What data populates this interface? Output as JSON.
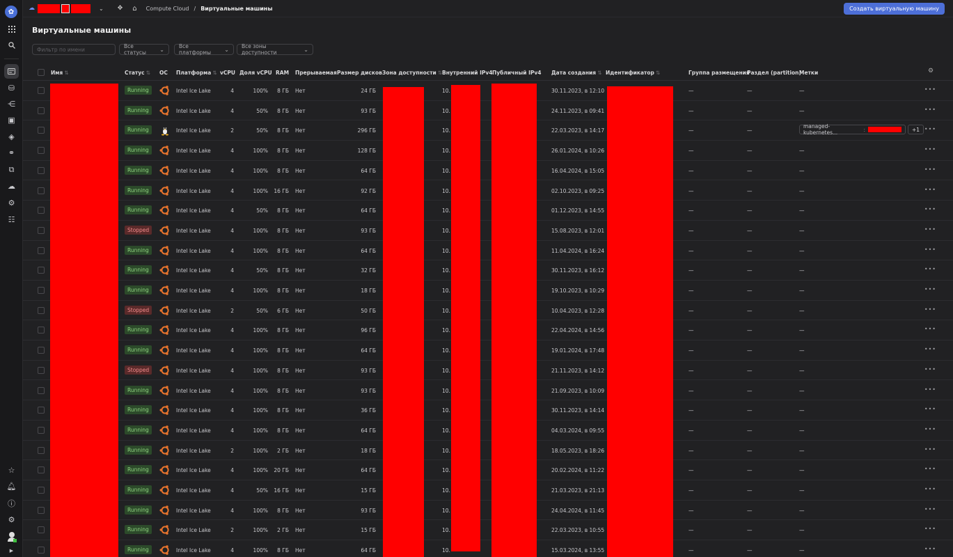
{
  "topbar": {
    "breadcrumb_service": "Compute Cloud",
    "breadcrumb_separator": "/",
    "breadcrumb_current": "Виртуальные машины",
    "create_button": "Создать виртуальную машину"
  },
  "page": {
    "title": "Виртуальные машины"
  },
  "filters": {
    "name_placeholder": "Фильтр по имени",
    "status": "Все статусы",
    "platform": "Все платформы",
    "zone": "Все зоны доступности"
  },
  "columns": {
    "name": "Имя",
    "status": "Статус",
    "os": "ОС",
    "platform": "Платформа",
    "vcpu": "vCPU",
    "vcpu_share": "Доля vCPU",
    "ram": "RAM",
    "preemptible": "Прерываемая",
    "disk": "Размер дисков",
    "zone": "Зона доступности",
    "ipv4_internal": "Внутренний IPv4",
    "ipv4_public": "Публичный IPv4",
    "created": "Дата создания",
    "id": "Идентификатор",
    "placement_group": "Группа размещения",
    "partition": "Раздел (partition)",
    "labels": "Метки"
  },
  "icons": {
    "logo": "settings-gear-logo",
    "apps": "grid-icon",
    "search": "search-icon",
    "os_ubuntu": "ubuntu-icon",
    "os_linux": "tux-icon",
    "more": "ellipsis-icon"
  },
  "colors": {
    "accent": "#4d6fd8",
    "running": "#8fd27f",
    "stopped": "#f08a8a",
    "redaction": "#ff0000"
  },
  "rows": [
    {
      "status": "Running",
      "os": "ubuntu",
      "platform": "Intel Ice Lake",
      "vcpu": "4",
      "share": "100%",
      "ram": "8 ГБ",
      "pre": "Нет",
      "disk": "24 ГБ",
      "ip": "10.",
      "created": "30.11.2023, в 12:10",
      "pg": "—",
      "part": "—",
      "labels": "—"
    },
    {
      "status": "Running",
      "os": "ubuntu",
      "platform": "Intel Ice Lake",
      "vcpu": "4",
      "share": "50%",
      "ram": "8 ГБ",
      "pre": "Нет",
      "disk": "93 ГБ",
      "ip": "10.",
      "created": "24.11.2023, в 09:41",
      "pg": "—",
      "part": "—",
      "labels": "—"
    },
    {
      "status": "Running",
      "os": "linux",
      "platform": "Intel Ice Lake",
      "vcpu": "2",
      "share": "50%",
      "ram": "8 ГБ",
      "pre": "Нет",
      "disk": "296 ГБ",
      "ip": "10.",
      "created": "22.03.2023, в 14:17",
      "pg": "—",
      "part": "—",
      "labels": "managed-kubernetes...",
      "labels_more": "+1"
    },
    {
      "status": "Running",
      "os": "ubuntu",
      "platform": "Intel Ice Lake",
      "vcpu": "4",
      "share": "100%",
      "ram": "8 ГБ",
      "pre": "Нет",
      "disk": "128 ГБ",
      "ip": "10.",
      "created": "26.01.2024, в 10:26",
      "pg": "—",
      "part": "—",
      "labels": "—"
    },
    {
      "status": "Running",
      "os": "ubuntu",
      "platform": "Intel Ice Lake",
      "vcpu": "4",
      "share": "100%",
      "ram": "8 ГБ",
      "pre": "Нет",
      "disk": "64 ГБ",
      "ip": "10.",
      "created": "16.04.2024, в 15:05",
      "pg": "—",
      "part": "—",
      "labels": "—"
    },
    {
      "status": "Running",
      "os": "ubuntu",
      "platform": "Intel Ice Lake",
      "vcpu": "4",
      "share": "100%",
      "ram": "16 ГБ",
      "pre": "Нет",
      "disk": "92 ГБ",
      "ip": "10.",
      "created": "02.10.2023, в 09:25",
      "pg": "—",
      "part": "—",
      "labels": "—"
    },
    {
      "status": "Running",
      "os": "ubuntu",
      "platform": "Intel Ice Lake",
      "vcpu": "4",
      "share": "50%",
      "ram": "8 ГБ",
      "pre": "Нет",
      "disk": "64 ГБ",
      "ip": "10.",
      "created": "01.12.2023, в 14:55",
      "pg": "—",
      "part": "—",
      "labels": "—"
    },
    {
      "status": "Stopped",
      "os": "ubuntu",
      "platform": "Intel Ice Lake",
      "vcpu": "4",
      "share": "100%",
      "ram": "8 ГБ",
      "pre": "Нет",
      "disk": "93 ГБ",
      "ip": "10.",
      "created": "15.08.2023, в 12:01",
      "pg": "—",
      "part": "—",
      "labels": "—"
    },
    {
      "status": "Running",
      "os": "ubuntu",
      "platform": "Intel Ice Lake",
      "vcpu": "4",
      "share": "100%",
      "ram": "8 ГБ",
      "pre": "Нет",
      "disk": "64 ГБ",
      "ip": "10.",
      "created": "11.04.2024, в 16:24",
      "pg": "—",
      "part": "—",
      "labels": "—"
    },
    {
      "status": "Running",
      "os": "ubuntu",
      "platform": "Intel Ice Lake",
      "vcpu": "4",
      "share": "50%",
      "ram": "8 ГБ",
      "pre": "Нет",
      "disk": "32 ГБ",
      "ip": "10.",
      "created": "30.11.2023, в 16:12",
      "pg": "—",
      "part": "—",
      "labels": "—"
    },
    {
      "status": "Running",
      "os": "ubuntu",
      "platform": "Intel Ice Lake",
      "vcpu": "4",
      "share": "100%",
      "ram": "8 ГБ",
      "pre": "Нет",
      "disk": "18 ГБ",
      "ip": "10.",
      "created": "19.10.2023, в 10:29",
      "pg": "—",
      "part": "—",
      "labels": "—"
    },
    {
      "status": "Stopped",
      "os": "ubuntu",
      "platform": "Intel Ice Lake",
      "vcpu": "2",
      "share": "50%",
      "ram": "6 ГБ",
      "pre": "Нет",
      "disk": "50 ГБ",
      "ip": "10.",
      "created": "10.04.2023, в 12:28",
      "pg": "—",
      "part": "—",
      "labels": "—"
    },
    {
      "status": "Running",
      "os": "ubuntu",
      "platform": "Intel Ice Lake",
      "vcpu": "4",
      "share": "100%",
      "ram": "8 ГБ",
      "pre": "Нет",
      "disk": "96 ГБ",
      "ip": "10.",
      "created": "22.04.2024, в 14:56",
      "pg": "—",
      "part": "—",
      "labels": "—"
    },
    {
      "status": "Running",
      "os": "ubuntu",
      "platform": "Intel Ice Lake",
      "vcpu": "4",
      "share": "100%",
      "ram": "8 ГБ",
      "pre": "Нет",
      "disk": "64 ГБ",
      "ip": "10.",
      "created": "19.01.2024, в 17:48",
      "pg": "—",
      "part": "—",
      "labels": "—"
    },
    {
      "status": "Stopped",
      "os": "ubuntu",
      "platform": "Intel Ice Lake",
      "vcpu": "4",
      "share": "100%",
      "ram": "8 ГБ",
      "pre": "Нет",
      "disk": "93 ГБ",
      "ip": "10.",
      "created": "21.11.2023, в 14:12",
      "pg": "—",
      "part": "—",
      "labels": "—"
    },
    {
      "status": "Running",
      "os": "ubuntu",
      "platform": "Intel Ice Lake",
      "vcpu": "4",
      "share": "100%",
      "ram": "8 ГБ",
      "pre": "Нет",
      "disk": "93 ГБ",
      "ip": "10.",
      "created": "21.09.2023, в 10:09",
      "pg": "—",
      "part": "—",
      "labels": "—"
    },
    {
      "status": "Running",
      "os": "ubuntu",
      "platform": "Intel Ice Lake",
      "vcpu": "4",
      "share": "100%",
      "ram": "8 ГБ",
      "pre": "Нет",
      "disk": "36 ГБ",
      "ip": "10.",
      "created": "30.11.2023, в 14:14",
      "pg": "—",
      "part": "—",
      "labels": "—"
    },
    {
      "status": "Running",
      "os": "ubuntu",
      "platform": "Intel Ice Lake",
      "vcpu": "4",
      "share": "100%",
      "ram": "8 ГБ",
      "pre": "Нет",
      "disk": "64 ГБ",
      "ip": "10.",
      "created": "04.03.2024, в 09:55",
      "pg": "—",
      "part": "—",
      "labels": "—"
    },
    {
      "status": "Running",
      "os": "ubuntu",
      "platform": "Intel Ice Lake",
      "vcpu": "2",
      "share": "100%",
      "ram": "2 ГБ",
      "pre": "Нет",
      "disk": "18 ГБ",
      "ip": "10.",
      "created": "18.05.2023, в 18:26",
      "pg": "—",
      "part": "—",
      "labels": "—"
    },
    {
      "status": "Running",
      "os": "ubuntu",
      "platform": "Intel Ice Lake",
      "vcpu": "4",
      "share": "100%",
      "ram": "20 ГБ",
      "pre": "Нет",
      "disk": "64 ГБ",
      "ip": "10.",
      "created": "20.02.2024, в 11:22",
      "pg": "—",
      "part": "—",
      "labels": "—"
    },
    {
      "status": "Running",
      "os": "ubuntu",
      "platform": "Intel Ice Lake",
      "vcpu": "4",
      "share": "50%",
      "ram": "16 ГБ",
      "pre": "Нет",
      "disk": "15 ГБ",
      "ip": "10.",
      "created": "21.03.2023, в 21:13",
      "pg": "—",
      "part": "—",
      "labels": "—"
    },
    {
      "status": "Running",
      "os": "ubuntu",
      "platform": "Intel Ice Lake",
      "vcpu": "4",
      "share": "100%",
      "ram": "8 ГБ",
      "pre": "Нет",
      "disk": "93 ГБ",
      "ip": "10.",
      "created": "24.04.2024, в 11:45",
      "pg": "—",
      "part": "—",
      "labels": "—"
    },
    {
      "status": "Running",
      "os": "ubuntu",
      "platform": "Intel Ice Lake",
      "vcpu": "2",
      "share": "100%",
      "ram": "2 ГБ",
      "pre": "Нет",
      "disk": "15 ГБ",
      "ip": "10.",
      "created": "22.03.2023, в 10:55",
      "pg": "—",
      "part": "—",
      "labels": "—"
    },
    {
      "status": "Running",
      "os": "ubuntu",
      "platform": "Intel Ice Lake",
      "vcpu": "4",
      "share": "100%",
      "ram": "8 ГБ",
      "pre": "Нет",
      "disk": "64 ГБ",
      "ip": "10.",
      "created": "15.03.2024, в 13:55",
      "pg": "—",
      "part": "—",
      "labels": "—"
    }
  ]
}
